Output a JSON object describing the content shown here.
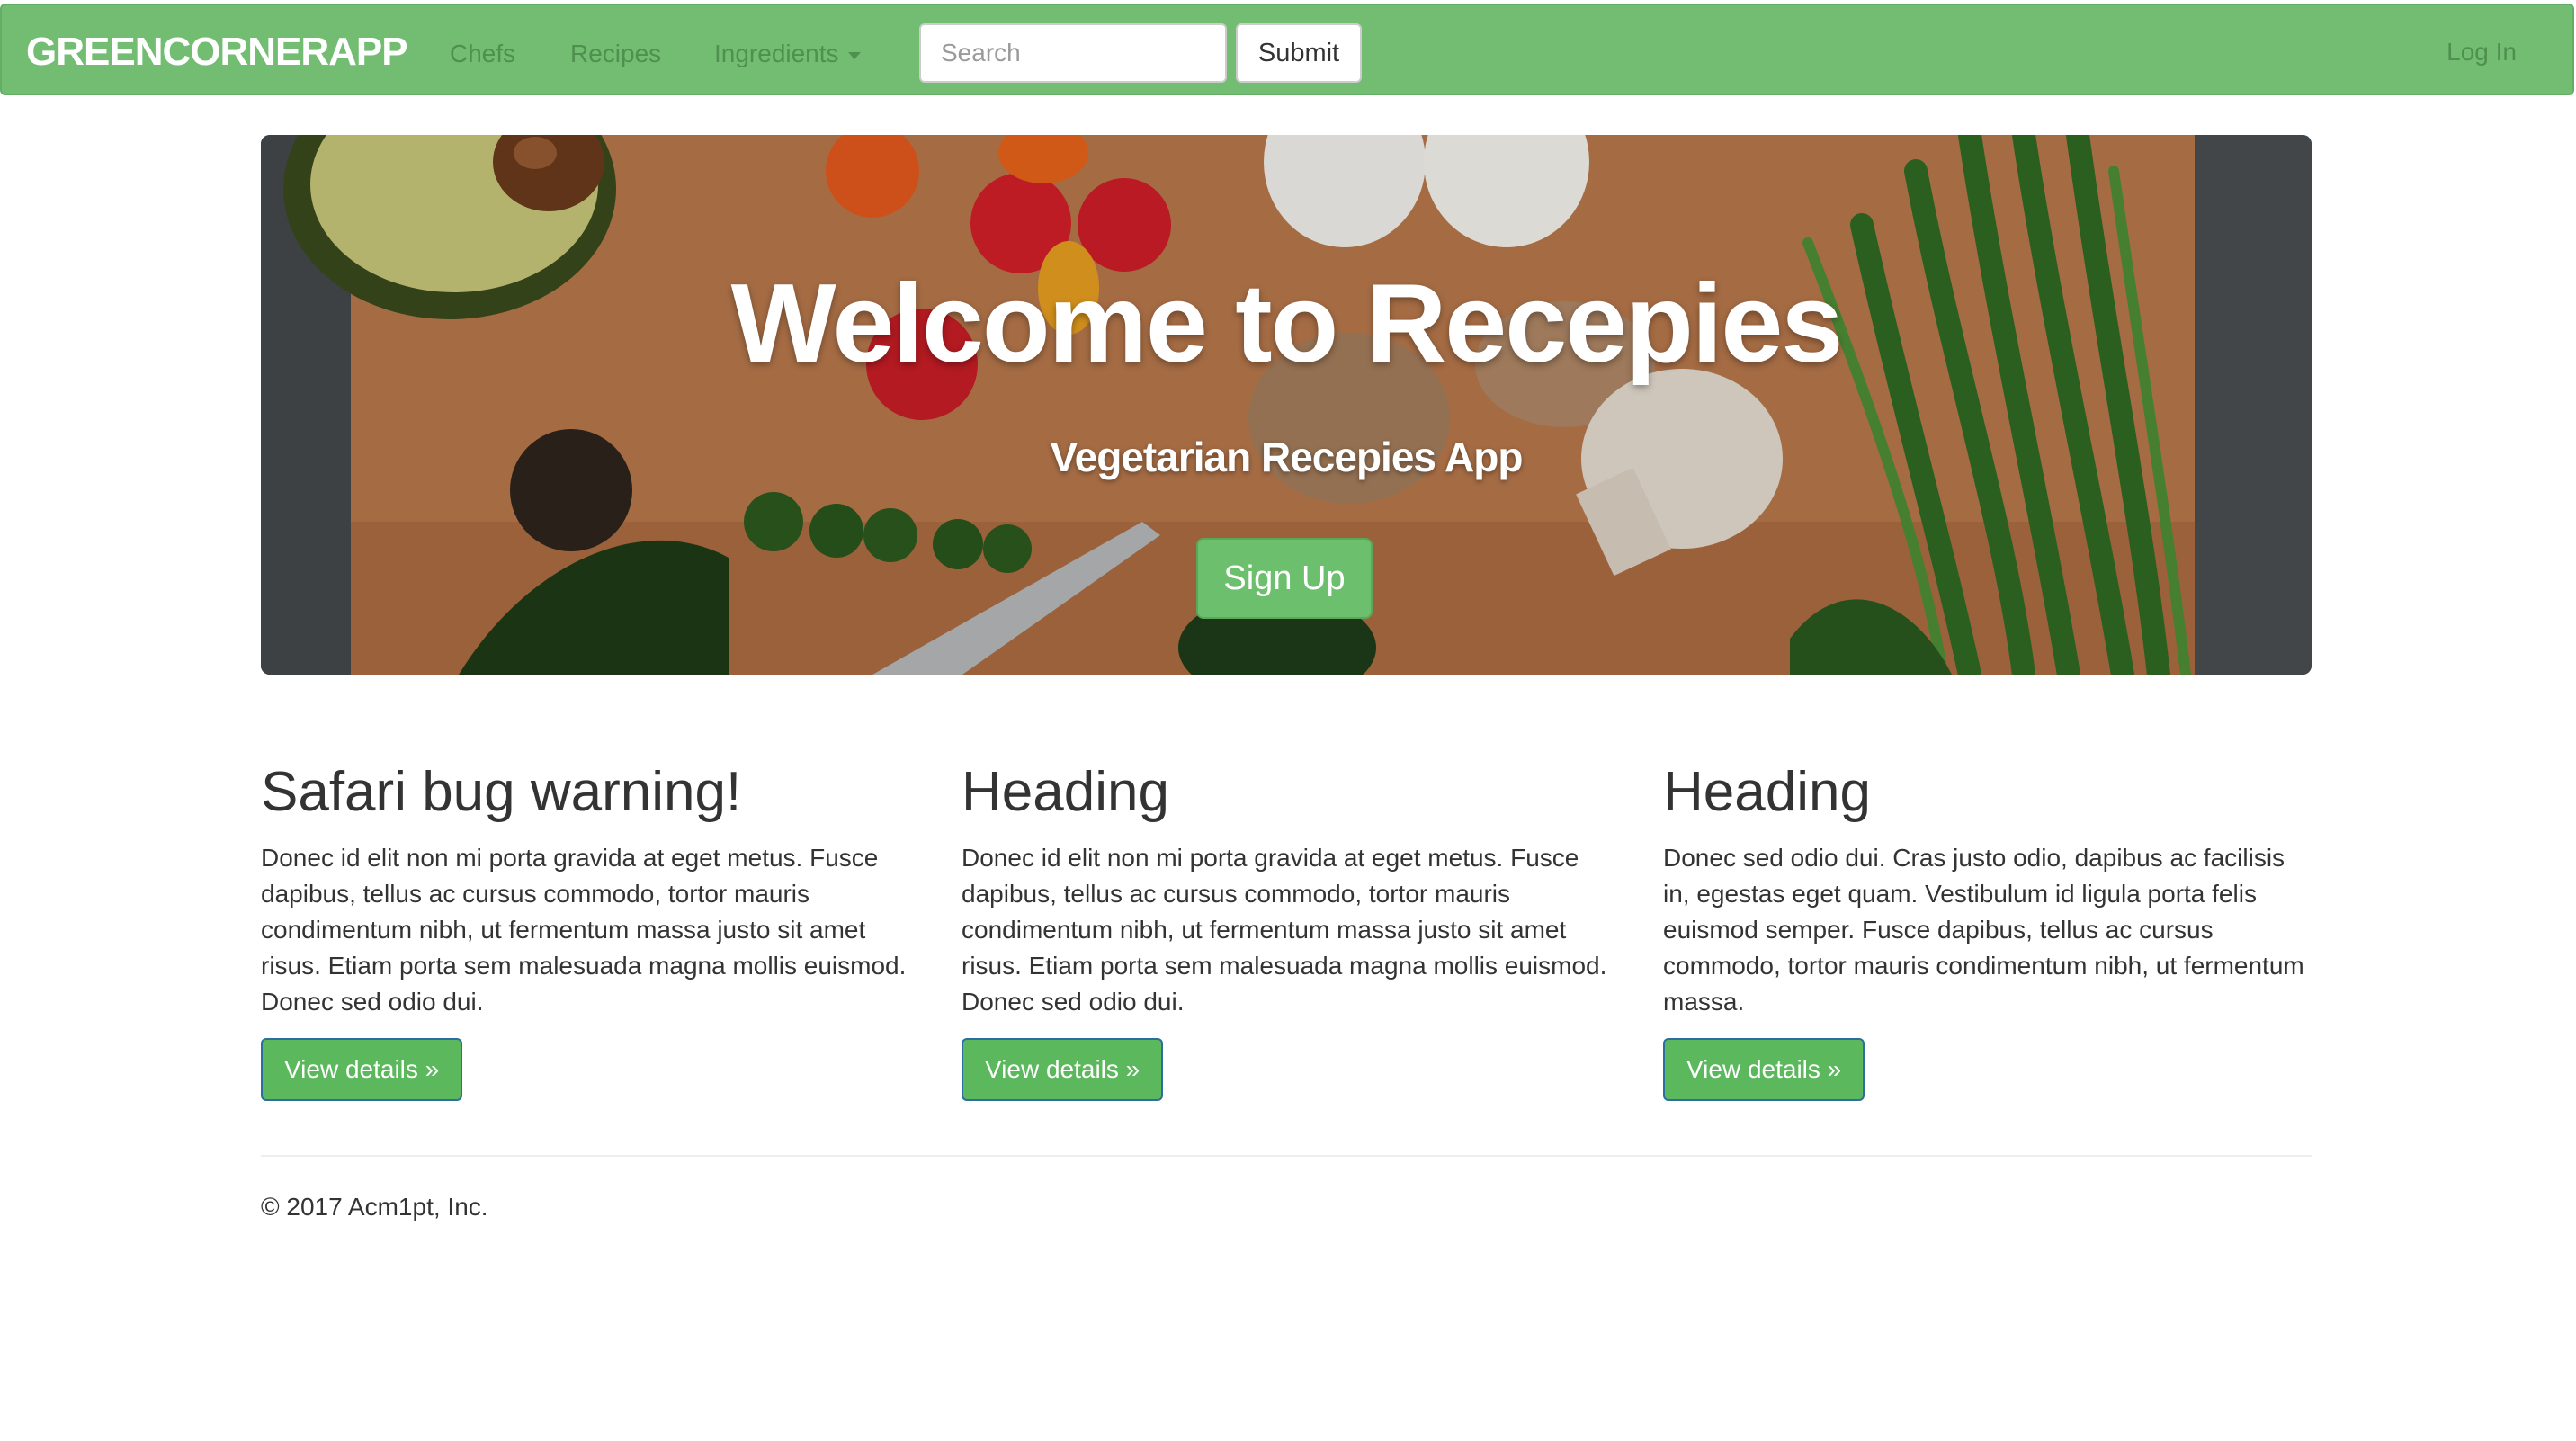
{
  "navbar": {
    "brand": "GREENCORNERAPP",
    "links": [
      "Chefs",
      "Recipes",
      "Ingredients"
    ],
    "search_placeholder": "Search",
    "submit_label": "Submit",
    "login_label": "Log In"
  },
  "hero": {
    "title": "Welcome to Recepies",
    "subtitle": "Vegetarian Recepies App",
    "signup_label": "Sign Up"
  },
  "columns": [
    {
      "heading": "Safari bug warning!",
      "body": "Donec id elit non mi porta gravida at eget metus. Fusce dapibus, tellus ac cursus commodo, tortor mauris condimentum nibh, ut fermentum massa justo sit amet risus. Etiam porta sem malesuada magna mollis euismod. Donec sed odio dui.",
      "button": "View details »"
    },
    {
      "heading": "Heading",
      "body": "Donec id elit non mi porta gravida at eget metus. Fusce dapibus, tellus ac cursus commodo, tortor mauris condimentum nibh, ut fermentum massa justo sit amet risus. Etiam porta sem malesuada magna mollis euismod. Donec sed odio dui.",
      "button": "View details »"
    },
    {
      "heading": "Heading",
      "body": "Donec sed odio dui. Cras justo odio, dapibus ac facilisis in, egestas eget quam. Vestibulum id ligula porta felis euismod semper. Fusce dapibus, tellus ac cursus commodo, tortor mauris condimentum nibh, ut fermentum massa.",
      "button": "View details »"
    }
  ],
  "footer": {
    "copyright": "© 2017 Acm1pt, Inc."
  },
  "colors": {
    "navbar": "#72bd72",
    "button_green": "#5cb85c",
    "text": "#333333"
  }
}
